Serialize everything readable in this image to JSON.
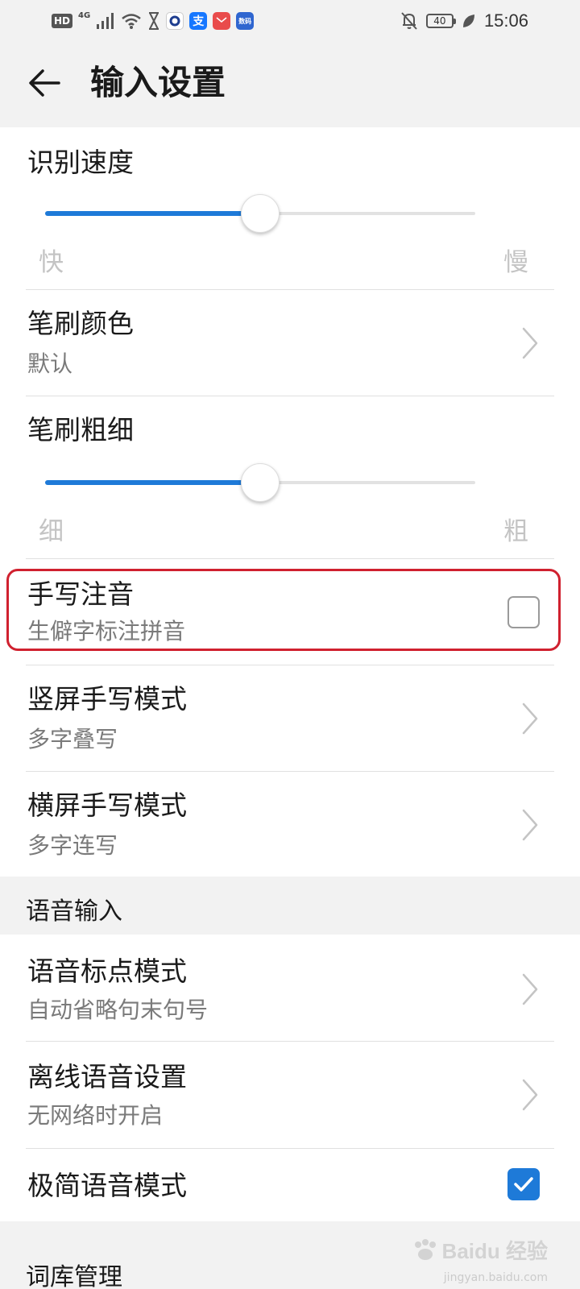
{
  "status_bar": {
    "hd": "HD",
    "network": "4G",
    "app_zhi": "支",
    "app_stats": "数码",
    "battery": "40",
    "time": "15:06"
  },
  "header": {
    "title": "输入设置"
  },
  "handwriting": {
    "recognition_speed": {
      "label": "识别速度",
      "value": 0.5,
      "min_label": "快",
      "max_label": "慢"
    },
    "brush_color": {
      "label": "笔刷颜色",
      "value": "默认"
    },
    "brush_thickness": {
      "label": "笔刷粗细",
      "value": 0.5,
      "min_label": "细",
      "max_label": "粗"
    },
    "phonetic": {
      "label": "手写注音",
      "description": "生僻字标注拼音",
      "checked": false
    },
    "portrait_mode": {
      "label": "竖屏手写模式",
      "value": "多字叠写"
    },
    "landscape_mode": {
      "label": "横屏手写模式",
      "value": "多字连写"
    }
  },
  "voice_input": {
    "section_title": "语音输入",
    "punctuation_mode": {
      "label": "语音标点模式",
      "value": "自动省略句末句号"
    },
    "offline_settings": {
      "label": "离线语音设置",
      "value": "无网络时开启"
    },
    "minimal_mode": {
      "label": "极简语音模式",
      "checked": true
    }
  },
  "dictionary": {
    "section_title": "词库管理"
  },
  "watermark": {
    "text": "Baidu 经验",
    "sub": "jingyan.baidu.com"
  },
  "colors": {
    "accent": "#1e7ad8",
    "highlight": "#d0212f",
    "background": "#f2f2f2",
    "card": "#ffffff"
  }
}
